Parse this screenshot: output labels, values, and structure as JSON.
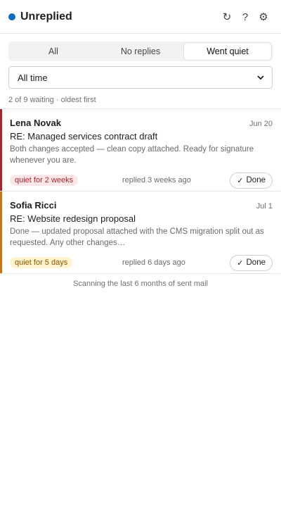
{
  "header": {
    "title": "Unreplied",
    "status_color": "#0f6cbd",
    "actions": [
      {
        "icon": "refresh-icon",
        "glyph": "↻"
      },
      {
        "icon": "help-icon",
        "glyph": "?"
      },
      {
        "icon": "settings-icon",
        "glyph": "⚙"
      }
    ]
  },
  "tabs": [
    {
      "label": "All",
      "active": false
    },
    {
      "label": "No replies",
      "active": false
    },
    {
      "label": "Went quiet",
      "active": true
    }
  ],
  "filter": {
    "selected": "All time"
  },
  "summary": "2 of 9 waiting · oldest first",
  "items": [
    {
      "sender": "Lena Novak",
      "date": "Jun 20",
      "subject": "RE: Managed services contract draft",
      "preview": "Both changes accepted — clean copy attached. Ready for signature whenever you are.",
      "badge": "quiet for 2 weeks",
      "badge_bg": "#fde7e9",
      "badge_fg": "#a4262c",
      "accent": "#a4262c",
      "replied": "replied 3 weeks ago",
      "done_label": "Done"
    },
    {
      "sender": "Sofia Ricci",
      "date": "Jul 1",
      "subject": "RE: Website redesign proposal",
      "preview": "Done — updated proposal attached with the CMS migration split out as requested. Any other changes…",
      "badge": "quiet for 5 days",
      "badge_bg": "#fff4ce",
      "badge_fg": "#8a5300",
      "accent": "#c8740d",
      "replied": "replied 6 days ago",
      "done_label": "Done"
    }
  ],
  "footer": "Scanning the last 6 months of sent mail"
}
